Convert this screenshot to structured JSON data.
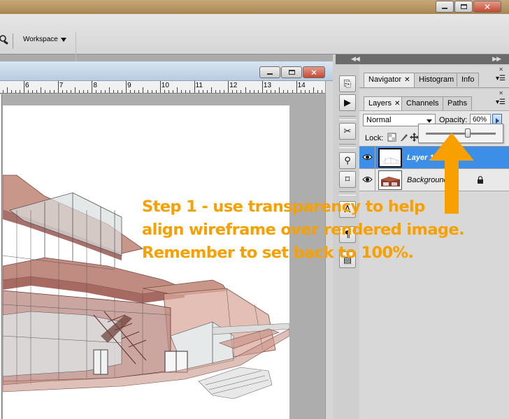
{
  "options_bar": {
    "workspace_label": "Workspace"
  },
  "ruler": {
    "labels": [
      "6",
      "7",
      "8",
      "9",
      "10",
      "11",
      "12",
      "13",
      "14"
    ]
  },
  "navigator_group": {
    "tabs": [
      {
        "label": "Navigator",
        "active": true
      },
      {
        "label": "Histogram",
        "active": false
      },
      {
        "label": "Info",
        "active": false
      }
    ]
  },
  "layers_group": {
    "tabs": [
      {
        "label": "Layers",
        "active": true
      },
      {
        "label": "Channels",
        "active": false
      },
      {
        "label": "Paths",
        "active": false
      }
    ],
    "blend_mode": "Normal",
    "opacity_label": "Opacity:",
    "opacity_value": "60%",
    "opacity_slider_fraction": 0.6,
    "lock_label": "Lock:",
    "layers": [
      {
        "name": "Layer 1",
        "selected": true,
        "visible": true,
        "locked": false
      },
      {
        "name": "Background",
        "selected": false,
        "visible": true,
        "locked": true
      }
    ]
  },
  "annotation": {
    "lines": [
      "Step 1 - use transparency to help",
      "align wireframe over rendered image.",
      "Remember to set back to 100%."
    ],
    "color": "#f7a000"
  },
  "colors": {
    "selection": "#3d8ee6",
    "accent": "#f7a000"
  }
}
